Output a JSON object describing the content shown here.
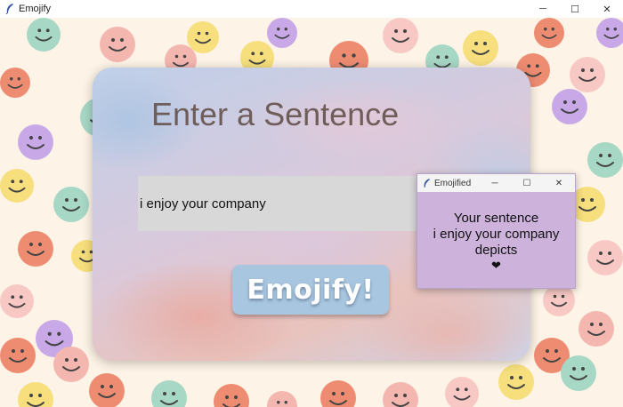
{
  "app": {
    "title": "Emojify",
    "icon": "feather-icon"
  },
  "window_controls": {
    "minimize": "─",
    "maximize": "☐",
    "close": "✕"
  },
  "main": {
    "heading": "Enter a Sentence",
    "input_value": "i enjoy your company",
    "button_label": "Emojify!"
  },
  "popup": {
    "title": "Emojified",
    "line1": "Your sentence",
    "line2": "i enjoy your company",
    "line3": "depicts",
    "emoji": "❤"
  },
  "colors": {
    "background": "#fdf3e6",
    "popup_bg": "#cdb2dc",
    "button_bg": "#a8c6e0",
    "heading": "#6f5d5a"
  }
}
